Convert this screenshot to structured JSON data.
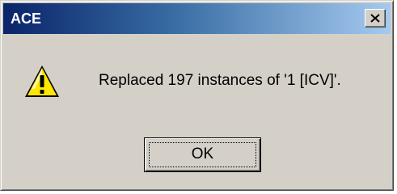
{
  "window": {
    "title": "ACE",
    "close_icon": "close-icon"
  },
  "body": {
    "icon": "warning-icon",
    "message": "Replaced 197 instances of '1 [ICV]'."
  },
  "buttons": {
    "ok_label": "OK"
  },
  "colors": {
    "title_gradient_start": "#0a246a",
    "title_gradient_end": "#a6caf0",
    "dialog_face": "#d4d0c8",
    "warning_yellow": "#ffe600"
  }
}
